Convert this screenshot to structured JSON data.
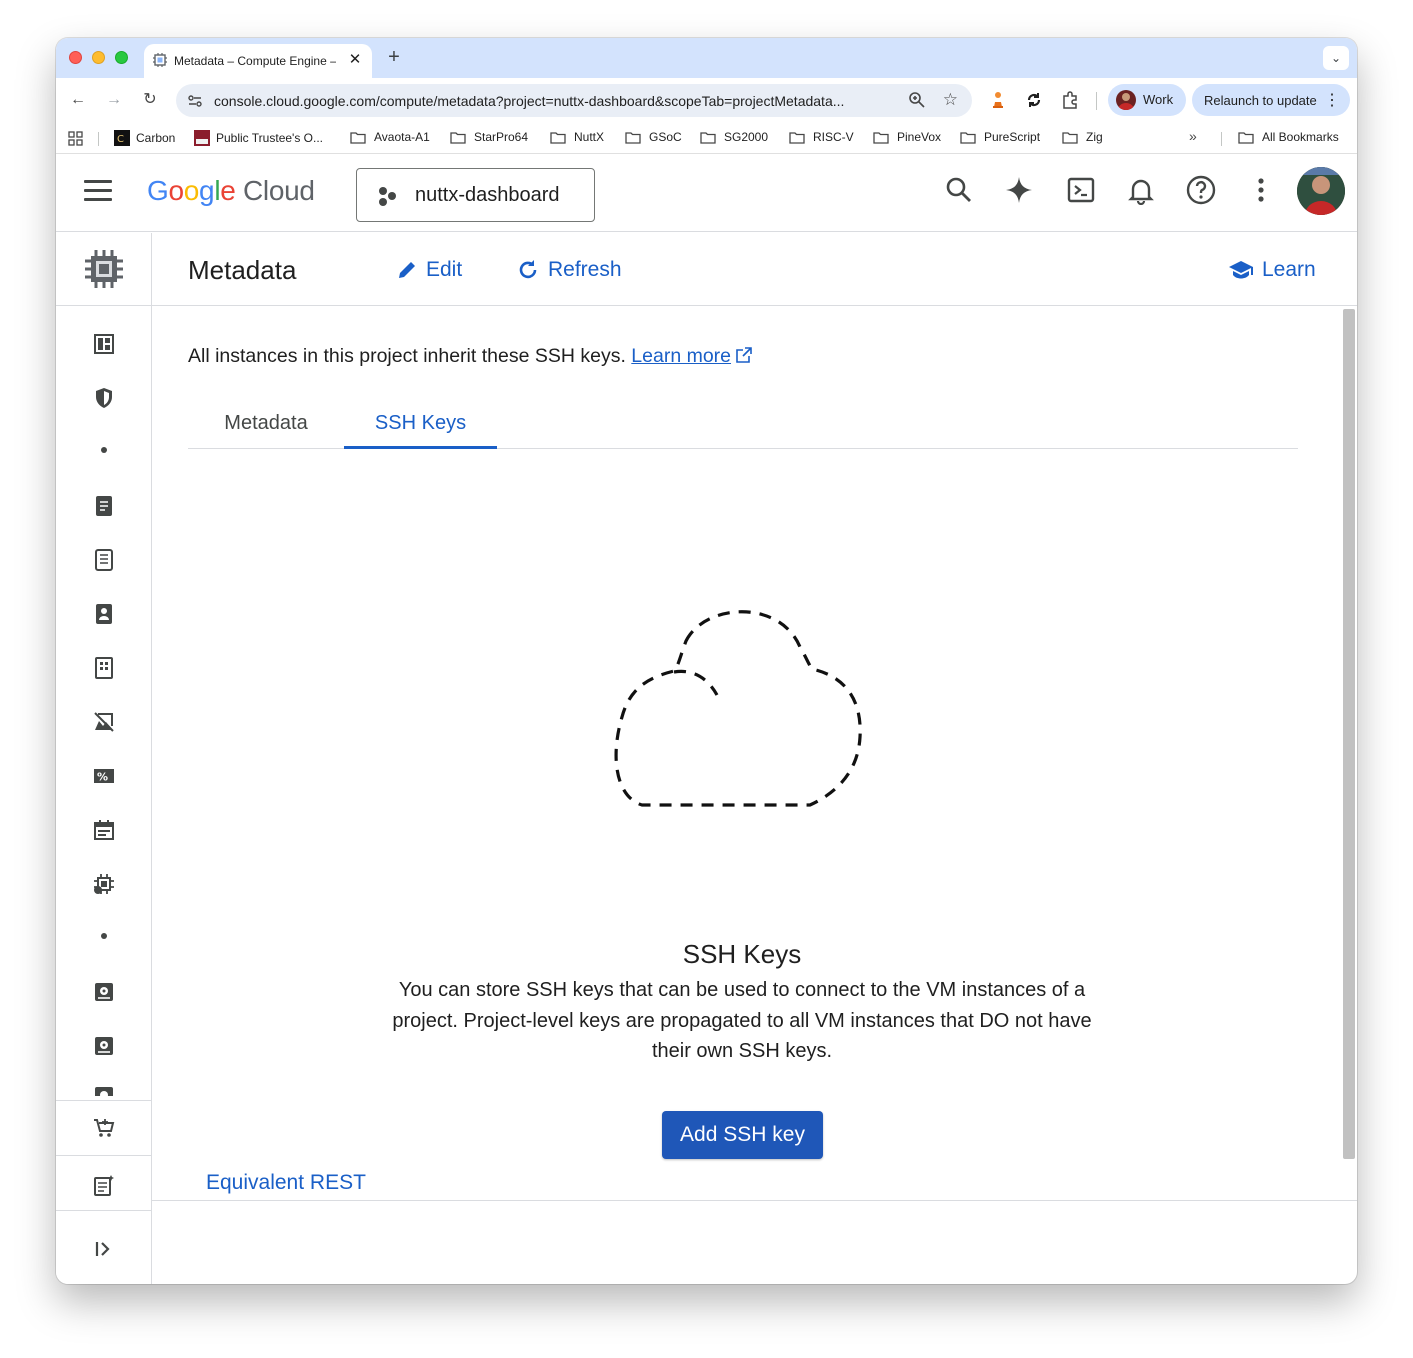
{
  "browser": {
    "tab_title": "Metadata – Compute Engine –",
    "tab_close": "✕",
    "new_tab": "+",
    "tab_menu": "⌄",
    "back": "←",
    "forward": "→",
    "reload": "↻",
    "url": "console.cloud.google.com/compute/metadata?project=nuttx-dashboard&scopeTab=projectMetadata...",
    "bookmark_star": "☆",
    "profile_label": "Work",
    "relaunch_label": "Relaunch to update",
    "relaunch_dots": "⋮",
    "bookmarks_more": "»",
    "bookmarks": [
      {
        "label": "Carbon",
        "type": "favicon"
      },
      {
        "label": "Public Trustee's O...",
        "type": "favicon"
      },
      {
        "label": "Avaota-A1",
        "type": "folder"
      },
      {
        "label": "StarPro64",
        "type": "folder"
      },
      {
        "label": "NuttX",
        "type": "folder"
      },
      {
        "label": "GSoC",
        "type": "folder"
      },
      {
        "label": "SG2000",
        "type": "folder"
      },
      {
        "label": "RISC-V",
        "type": "folder"
      },
      {
        "label": "PineVox",
        "type": "folder"
      },
      {
        "label": "PureScript",
        "type": "folder"
      },
      {
        "label": "Zig",
        "type": "folder"
      }
    ],
    "all_bookmarks": "All Bookmarks"
  },
  "gcp": {
    "logo": {
      "g": "G",
      "o1": "o",
      "o2": "o",
      "g2": "g",
      "l": "l",
      "e": "e",
      "cloud": "Cloud"
    },
    "project": "nuttx-dashboard",
    "icons": [
      "search-icon",
      "gemini-icon",
      "cloud-shell-icon",
      "notifications-icon",
      "help-icon",
      "more-vert-icon"
    ]
  },
  "page": {
    "title": "Metadata",
    "edit_label": "Edit",
    "refresh_label": "Refresh",
    "learn_label": "Learn",
    "intro_text": "All instances in this project inherit these SSH keys.",
    "learn_more": "Learn more",
    "tabs": [
      {
        "label": "Metadata",
        "active": false
      },
      {
        "label": "SSH Keys",
        "active": true
      }
    ],
    "empty_title": "SSH Keys",
    "empty_desc": "You can store SSH keys that can be used to connect to the VM instances of a project. Project-level keys are propagated to all VM instances that DO not have their own SSH keys.",
    "add_button": "Add SSH key",
    "equivalent_rest": "Equivalent REST"
  },
  "colors": {
    "accent": "#1a5fc7",
    "primary_button": "#1f57b8",
    "tabstrip": "#d3e3fd"
  }
}
